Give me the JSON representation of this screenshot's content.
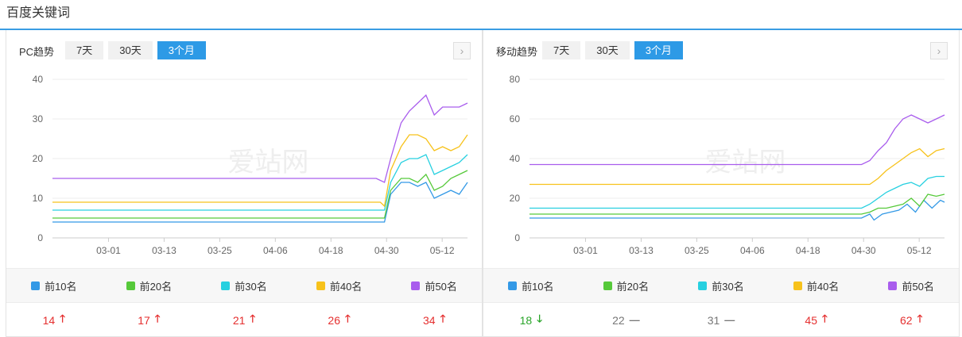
{
  "page": {
    "title": "百度关键词"
  },
  "colors": {
    "top10": "#3399e6",
    "top20": "#56c93a",
    "top30": "#27d0e0",
    "top40": "#f7c21b",
    "top50": "#a95ded",
    "up": "#e52f2f",
    "down": "#2aa52a",
    "flat": "#777777",
    "accent": "#2d9ae6"
  },
  "legend": [
    "前10名",
    "前20名",
    "前30名",
    "前40名",
    "前50名"
  ],
  "watermark": "爱站网",
  "panels": [
    {
      "label": "PC趋势",
      "tabs": [
        "7天",
        "30天",
        "3个月"
      ],
      "active_tab": "3个月",
      "next_icon": "chevron-right-icon",
      "next_glyph": "›",
      "values": [
        {
          "value": "14",
          "trend": "up",
          "glyph": "🡑"
        },
        {
          "value": "17",
          "trend": "up",
          "glyph": "🡑"
        },
        {
          "value": "21",
          "trend": "up",
          "glyph": "🡑"
        },
        {
          "value": "26",
          "trend": "up",
          "glyph": "🡑"
        },
        {
          "value": "34",
          "trend": "up",
          "glyph": "🡑"
        }
      ]
    },
    {
      "label": "移动趋势",
      "tabs": [
        "7天",
        "30天",
        "3个月"
      ],
      "active_tab": "3个月",
      "next_icon": "chevron-right-icon",
      "next_glyph": "›",
      "values": [
        {
          "value": "18",
          "trend": "down",
          "glyph": "🡓"
        },
        {
          "value": "22",
          "trend": "flat",
          "glyph": "—"
        },
        {
          "value": "31",
          "trend": "flat",
          "glyph": "—"
        },
        {
          "value": "45",
          "trend": "up",
          "glyph": "🡑"
        },
        {
          "value": "62",
          "trend": "up",
          "glyph": "🡑"
        }
      ]
    }
  ],
  "chart_data": [
    {
      "type": "line",
      "x_ticks": [
        "03-01",
        "03-13",
        "03-25",
        "04-06",
        "04-18",
        "04-30",
        "05-12"
      ],
      "ylim": [
        0,
        40
      ],
      "y_ticks": [
        0,
        10,
        20,
        30,
        40
      ],
      "grid": true,
      "series": [
        {
          "name": "前10名",
          "color": "#3399e6",
          "points": [
            [
              0,
              4
            ],
            [
              0.79,
              4
            ],
            [
              0.8,
              4
            ],
            [
              0.815,
              11
            ],
            [
              0.84,
              14
            ],
            [
              0.86,
              14
            ],
            [
              0.88,
              13
            ],
            [
              0.9,
              14
            ],
            [
              0.92,
              10
            ],
            [
              0.94,
              11
            ],
            [
              0.96,
              12
            ],
            [
              0.98,
              11
            ],
            [
              1,
              14
            ]
          ]
        },
        {
          "name": "前20名",
          "color": "#56c93a",
          "points": [
            [
              0,
              5
            ],
            [
              0.79,
              5
            ],
            [
              0.8,
              5
            ],
            [
              0.815,
              12
            ],
            [
              0.84,
              15
            ],
            [
              0.86,
              15
            ],
            [
              0.88,
              14
            ],
            [
              0.9,
              16
            ],
            [
              0.92,
              12
            ],
            [
              0.94,
              13
            ],
            [
              0.96,
              15
            ],
            [
              0.98,
              16
            ],
            [
              1,
              17
            ]
          ]
        },
        {
          "name": "前30名",
          "color": "#27d0e0",
          "points": [
            [
              0,
              7
            ],
            [
              0.79,
              7
            ],
            [
              0.8,
              7
            ],
            [
              0.815,
              14
            ],
            [
              0.84,
              19
            ],
            [
              0.86,
              20
            ],
            [
              0.88,
              20
            ],
            [
              0.9,
              21
            ],
            [
              0.92,
              16
            ],
            [
              0.94,
              17
            ],
            [
              0.96,
              18
            ],
            [
              0.98,
              19
            ],
            [
              1,
              21
            ]
          ]
        },
        {
          "name": "前40名",
          "color": "#f7c21b",
          "points": [
            [
              0,
              9
            ],
            [
              0.79,
              9
            ],
            [
              0.8,
              8
            ],
            [
              0.815,
              17
            ],
            [
              0.84,
              23
            ],
            [
              0.86,
              26
            ],
            [
              0.88,
              26
            ],
            [
              0.9,
              25
            ],
            [
              0.92,
              22
            ],
            [
              0.94,
              23
            ],
            [
              0.96,
              22
            ],
            [
              0.98,
              23
            ],
            [
              1,
              26
            ]
          ]
        },
        {
          "name": "前50名",
          "color": "#a95ded",
          "points": [
            [
              0,
              15
            ],
            [
              0.78,
              15
            ],
            [
              0.8,
              14
            ],
            [
              0.815,
              20
            ],
            [
              0.84,
              29
            ],
            [
              0.86,
              32
            ],
            [
              0.88,
              34
            ],
            [
              0.9,
              36
            ],
            [
              0.92,
              31
            ],
            [
              0.94,
              33
            ],
            [
              0.96,
              33
            ],
            [
              0.98,
              33
            ],
            [
              1,
              34
            ]
          ]
        }
      ]
    },
    {
      "type": "line",
      "x_ticks": [
        "03-01",
        "03-13",
        "03-25",
        "04-06",
        "04-18",
        "04-30",
        "05-12"
      ],
      "ylim": [
        0,
        80
      ],
      "y_ticks": [
        0,
        20,
        40,
        60,
        80
      ],
      "grid": true,
      "series": [
        {
          "name": "前10名",
          "color": "#3399e6",
          "points": [
            [
              0,
              10
            ],
            [
              0.79,
              10
            ],
            [
              0.8,
              10
            ],
            [
              0.82,
              12
            ],
            [
              0.83,
              9
            ],
            [
              0.85,
              12
            ],
            [
              0.87,
              13
            ],
            [
              0.89,
              14
            ],
            [
              0.91,
              17
            ],
            [
              0.93,
              13
            ],
            [
              0.95,
              19
            ],
            [
              0.97,
              15
            ],
            [
              0.99,
              19
            ],
            [
              1,
              18
            ]
          ]
        },
        {
          "name": "前20名",
          "color": "#56c93a",
          "points": [
            [
              0,
              12
            ],
            [
              0.79,
              12
            ],
            [
              0.8,
              12
            ],
            [
              0.82,
              13
            ],
            [
              0.84,
              15
            ],
            [
              0.86,
              15
            ],
            [
              0.88,
              16
            ],
            [
              0.9,
              17
            ],
            [
              0.92,
              20
            ],
            [
              0.94,
              16
            ],
            [
              0.96,
              22
            ],
            [
              0.98,
              21
            ],
            [
              1,
              22
            ]
          ]
        },
        {
          "name": "前30名",
          "color": "#27d0e0",
          "points": [
            [
              0,
              15
            ],
            [
              0.79,
              15
            ],
            [
              0.8,
              15
            ],
            [
              0.82,
              17
            ],
            [
              0.84,
              20
            ],
            [
              0.86,
              23
            ],
            [
              0.88,
              25
            ],
            [
              0.9,
              27
            ],
            [
              0.92,
              28
            ],
            [
              0.94,
              26
            ],
            [
              0.96,
              30
            ],
            [
              0.98,
              31
            ],
            [
              1,
              31
            ]
          ]
        },
        {
          "name": "前40名",
          "color": "#f7c21b",
          "points": [
            [
              0,
              27
            ],
            [
              0.79,
              27
            ],
            [
              0.8,
              27
            ],
            [
              0.82,
              27
            ],
            [
              0.84,
              30
            ],
            [
              0.86,
              34
            ],
            [
              0.88,
              37
            ],
            [
              0.9,
              40
            ],
            [
              0.92,
              43
            ],
            [
              0.94,
              45
            ],
            [
              0.96,
              41
            ],
            [
              0.98,
              44
            ],
            [
              1,
              45
            ]
          ]
        },
        {
          "name": "前50名",
          "color": "#a95ded",
          "points": [
            [
              0,
              37
            ],
            [
              0.79,
              37
            ],
            [
              0.8,
              37
            ],
            [
              0.82,
              39
            ],
            [
              0.84,
              44
            ],
            [
              0.86,
              48
            ],
            [
              0.88,
              55
            ],
            [
              0.9,
              60
            ],
            [
              0.92,
              62
            ],
            [
              0.94,
              60
            ],
            [
              0.96,
              58
            ],
            [
              0.98,
              60
            ],
            [
              1,
              62
            ]
          ]
        }
      ]
    }
  ]
}
